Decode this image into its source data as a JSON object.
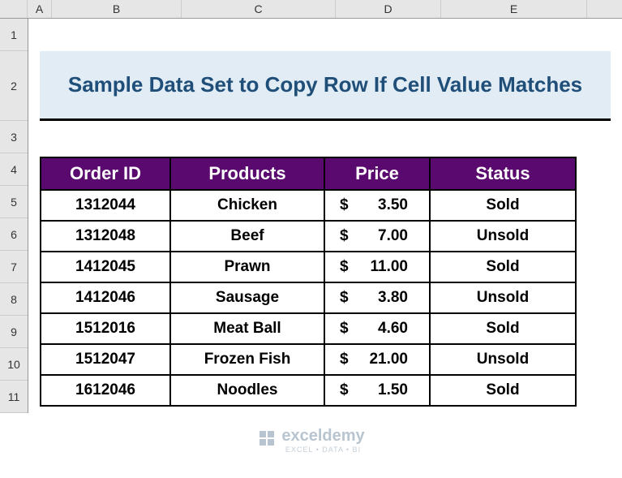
{
  "columns": {
    "A": "A",
    "B": "B",
    "C": "C",
    "D": "D",
    "E": "E"
  },
  "rows": {
    "r1": "1",
    "r2": "2",
    "r3": "3",
    "r4": "4",
    "r5": "5",
    "r6": "6",
    "r7": "7",
    "r8": "8",
    "r9": "9",
    "r10": "10",
    "r11": "11"
  },
  "title": "Sample Data Set to Copy Row If Cell Value Matches",
  "headers": {
    "order_id": "Order ID",
    "products": "Products",
    "price": "Price",
    "status": "Status"
  },
  "currency": "$",
  "data_rows": [
    {
      "order_id": "1312044",
      "product": "Chicken",
      "price": "3.50",
      "status": "Sold"
    },
    {
      "order_id": "1312048",
      "product": "Beef",
      "price": "7.00",
      "status": "Unsold"
    },
    {
      "order_id": "1412045",
      "product": "Prawn",
      "price": "11.00",
      "status": "Sold"
    },
    {
      "order_id": "1412046",
      "product": "Sausage",
      "price": "3.80",
      "status": "Unsold"
    },
    {
      "order_id": "1512016",
      "product": "Meat Ball",
      "price": "4.60",
      "status": "Sold"
    },
    {
      "order_id": "1512047",
      "product": "Frozen Fish",
      "price": "21.00",
      "status": "Unsold"
    },
    {
      "order_id": "1612046",
      "product": "Noodles",
      "price": "1.50",
      "status": "Sold"
    }
  ],
  "watermark": {
    "brand": "exceldemy",
    "tagline": "EXCEL • DATA • BI"
  },
  "chart_data": {
    "type": "table",
    "title": "Sample Data Set to Copy Row If Cell Value Matches",
    "columns": [
      "Order ID",
      "Products",
      "Price",
      "Status"
    ],
    "rows": [
      [
        "1312044",
        "Chicken",
        3.5,
        "Sold"
      ],
      [
        "1312048",
        "Beef",
        7.0,
        "Unsold"
      ],
      [
        "1412045",
        "Prawn",
        11.0,
        "Sold"
      ],
      [
        "1412046",
        "Sausage",
        3.8,
        "Unsold"
      ],
      [
        "1512016",
        "Meat Ball",
        4.6,
        "Sold"
      ],
      [
        "1512047",
        "Frozen Fish",
        21.0,
        "Unsold"
      ],
      [
        "1612046",
        "Noodles",
        1.5,
        "Sold"
      ]
    ]
  }
}
